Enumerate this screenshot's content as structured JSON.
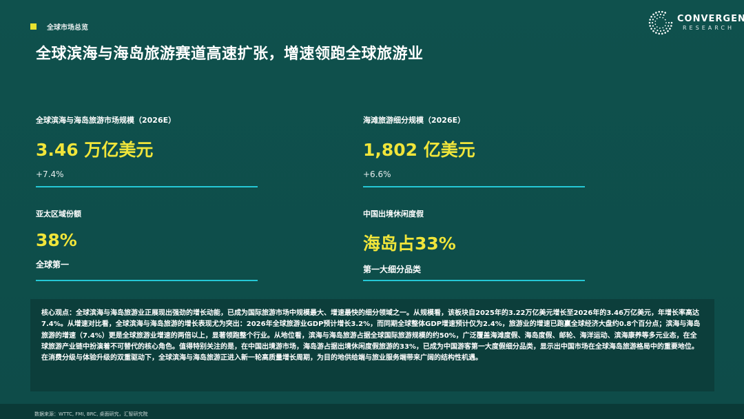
{
  "header": {
    "section_tag": "全球市场总览",
    "title": "全球滨海与海岛旅游赛道高速扩张，增速领跑全球旅游业"
  },
  "logo": {
    "name": "CONVERGENT",
    "sub": "RESEARCH",
    "icon": "dotted-circle-logo-icon"
  },
  "metrics": [
    {
      "label": "全球滨海与海岛旅游市场规模（2026E）",
      "value": "3.46 万亿美元",
      "sub": "+7.4%"
    },
    {
      "label": "海滩旅游细分规模（2026E）",
      "value": "1,802 亿美元",
      "sub": "+6.6%"
    },
    {
      "label": "亚太区域份额",
      "value": "38%",
      "sub": "全球第一"
    },
    {
      "label": "中国出境休闲度假",
      "value": "海岛占33%",
      "sub": "第一大细分品类"
    }
  ],
  "insight": {
    "heading": "核心观点：",
    "body": "全球滨海与海岛旅游业正展现出强劲的增长动能，已成为国际旅游市场中规模最大、增速最快的细分领域之一。从规模看，该板块自2025年的3.22万亿美元增长至2026年的3.46万亿美元，年增长率高达7.4%。从增速对比看，全球滨海与海岛旅游的增长表现尤为突出：2026年全球旅游业GDP预计增长3.2%，而同期全球整体GDP增速预计仅为2.4%，旅游业的增速已跑赢全球经济大盘约0.8个百分点；滨海与海岛旅游的增速（7.4%）更是全球旅游业增速的两倍以上，显著领跑整个行业。从地位看，滨海与海岛旅游占据全球国际旅游规模的约50%，广泛覆盖海滩度假、海岛度假、邮轮、海洋运动、滨海康养等多元业态，在全球旅游产业链中扮演着不可替代的核心角色。值得特别关注的是，在中国出境游市场，海岛游占据出境休闲度假旅游的33%，已成为中国游客第一大度假细分品类，显示出中国市场在全球海岛旅游格局中的重要地位。在消费分级与体验升级的双重驱动下，全球滨海与海岛旅游正进入新一轮高质量增长周期，为目的地供给端与旅业服务端带来广阔的结构性机遇。"
  },
  "footer": {
    "source": "数据来源：WTTC, FMI, BRC, 桌面研究，汇智研究院"
  },
  "colors": {
    "background": "#0f4f4c",
    "accent_yellow": "#f0e53a",
    "accent_cyan": "#25c9d6"
  }
}
